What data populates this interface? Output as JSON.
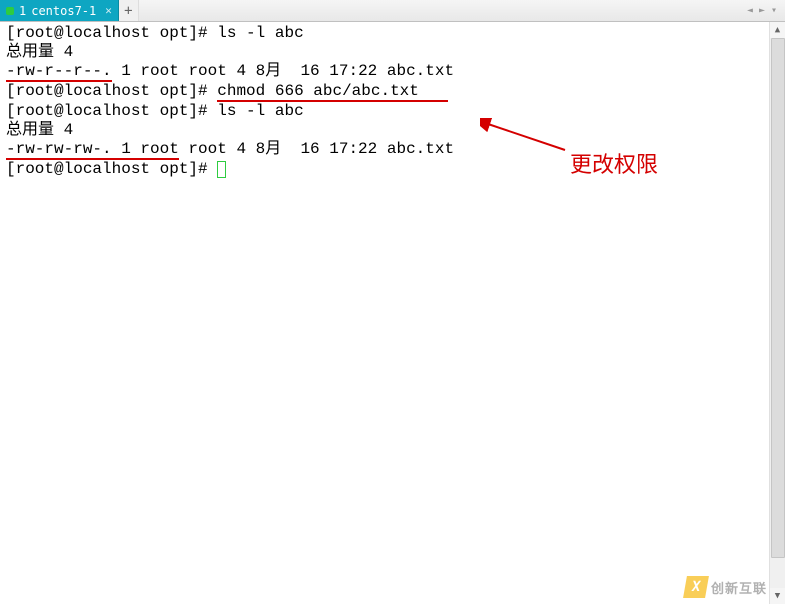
{
  "tab": {
    "index": "1",
    "title": "centos7-1"
  },
  "terminal": {
    "prompt": "[root@localhost opt]#",
    "cmd1": "ls -l abc",
    "total_line": "总用量 4",
    "listing_perm1": "-rw-r--r--.",
    "listing_rest1": " 1 root root 4 8月  16 17:22 abc.txt",
    "cmd2_pre": " ",
    "cmd2": "chmod 666 abc/abc.txt",
    "cmd3": "ls -l abc",
    "listing_perm2_a": "-rw-rw-rw-. 1 root",
    "listing_rest2": " root 4 8月  16 17:22 abc.txt"
  },
  "annotation": {
    "label": "更改权限"
  },
  "watermark": {
    "badge": "X",
    "text": "创新互联"
  }
}
